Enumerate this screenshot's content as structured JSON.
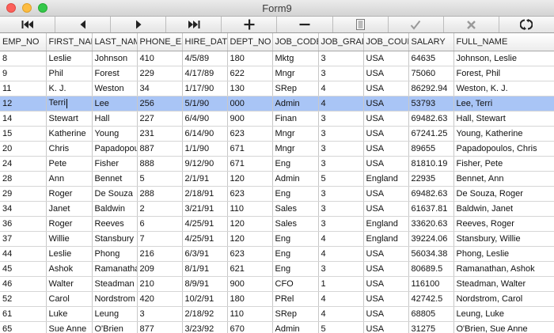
{
  "window": {
    "title": "Form9"
  },
  "colors": {
    "selection": "#a9c5f6",
    "close": "#fc605b",
    "minimize": "#fdbc40",
    "maximize": "#34c84a"
  },
  "toolbar": {
    "buttons": [
      {
        "icon": "first-record-icon"
      },
      {
        "icon": "prior-record-icon"
      },
      {
        "icon": "next-record-icon"
      },
      {
        "icon": "last-record-icon"
      },
      {
        "icon": "insert-record-icon"
      },
      {
        "icon": "delete-record-icon"
      },
      {
        "icon": "edit-record-icon"
      },
      {
        "icon": "post-edit-icon"
      },
      {
        "icon": "cancel-edit-icon"
      },
      {
        "icon": "refresh-icon"
      }
    ]
  },
  "grid": {
    "columns": [
      "EMP_NO",
      "FIRST_NAM",
      "LAST_NAM",
      "PHONE_EX",
      "HIRE_DATE",
      "DEPT_NO",
      "JOB_CODE",
      "JOB_GRAD",
      "JOB_COUN",
      "SALARY",
      "FULL_NAME"
    ],
    "selected_row": 3,
    "rows": [
      [
        "8",
        "Leslie",
        "Johnson",
        "410",
        "4/5/89",
        "180",
        "Mktg",
        "3",
        "USA",
        "64635",
        "Johnson, Leslie"
      ],
      [
        "9",
        "Phil",
        "Forest",
        "229",
        "4/17/89",
        "622",
        "Mngr",
        "3",
        "USA",
        "75060",
        "Forest, Phil"
      ],
      [
        "11",
        "K. J.",
        "Weston",
        "34",
        "1/17/90",
        "130",
        "SRep",
        "4",
        "USA",
        "86292.94",
        "Weston, K. J."
      ],
      [
        "12",
        "Terri",
        "Lee",
        "256",
        "5/1/90",
        "000",
        "Admin",
        "4",
        "USA",
        "53793",
        "Lee, Terri"
      ],
      [
        "14",
        "Stewart",
        "Hall",
        "227",
        "6/4/90",
        "900",
        "Finan",
        "3",
        "USA",
        "69482.63",
        "Hall, Stewart"
      ],
      [
        "15",
        "Katherine",
        "Young",
        "231",
        "6/14/90",
        "623",
        "Mngr",
        "3",
        "USA",
        "67241.25",
        "Young, Katherine"
      ],
      [
        "20",
        "Chris",
        "Papadopou",
        "887",
        "1/1/90",
        "671",
        "Mngr",
        "3",
        "USA",
        "89655",
        "Papadopoulos, Chris"
      ],
      [
        "24",
        "Pete",
        "Fisher",
        "888",
        "9/12/90",
        "671",
        "Eng",
        "3",
        "USA",
        "81810.19",
        "Fisher, Pete"
      ],
      [
        "28",
        "Ann",
        "Bennet",
        "5",
        "2/1/91",
        "120",
        "Admin",
        "5",
        "England",
        "22935",
        "Bennet, Ann"
      ],
      [
        "29",
        "Roger",
        "De Souza",
        "288",
        "2/18/91",
        "623",
        "Eng",
        "3",
        "USA",
        "69482.63",
        "De Souza, Roger"
      ],
      [
        "34",
        "Janet",
        "Baldwin",
        "2",
        "3/21/91",
        "110",
        "Sales",
        "3",
        "USA",
        "61637.81",
        "Baldwin, Janet"
      ],
      [
        "36",
        "Roger",
        "Reeves",
        "6",
        "4/25/91",
        "120",
        "Sales",
        "3",
        "England",
        "33620.63",
        "Reeves, Roger"
      ],
      [
        "37",
        "Willie",
        "Stansbury",
        "7",
        "4/25/91",
        "120",
        "Eng",
        "4",
        "England",
        "39224.06",
        "Stansbury, Willie"
      ],
      [
        "44",
        "Leslie",
        "Phong",
        "216",
        "6/3/91",
        "623",
        "Eng",
        "4",
        "USA",
        "56034.38",
        "Phong, Leslie"
      ],
      [
        "45",
        "Ashok",
        "Ramanatha",
        "209",
        "8/1/91",
        "621",
        "Eng",
        "3",
        "USA",
        "80689.5",
        "Ramanathan, Ashok"
      ],
      [
        "46",
        "Walter",
        "Steadman",
        "210",
        "8/9/91",
        "900",
        "CFO",
        "1",
        "USA",
        "116100",
        "Steadman, Walter"
      ],
      [
        "52",
        "Carol",
        "Nordstrom",
        "420",
        "10/2/91",
        "180",
        "PRel",
        "4",
        "USA",
        "42742.5",
        "Nordstrom, Carol"
      ],
      [
        "61",
        "Luke",
        "Leung",
        "3",
        "2/18/92",
        "110",
        "SRep",
        "4",
        "USA",
        "68805",
        "Leung, Luke"
      ],
      [
        "65",
        "Sue Anne",
        "O'Brien",
        "877",
        "3/23/92",
        "670",
        "Admin",
        "5",
        "USA",
        "31275",
        "O'Brien, Sue Anne"
      ]
    ]
  }
}
